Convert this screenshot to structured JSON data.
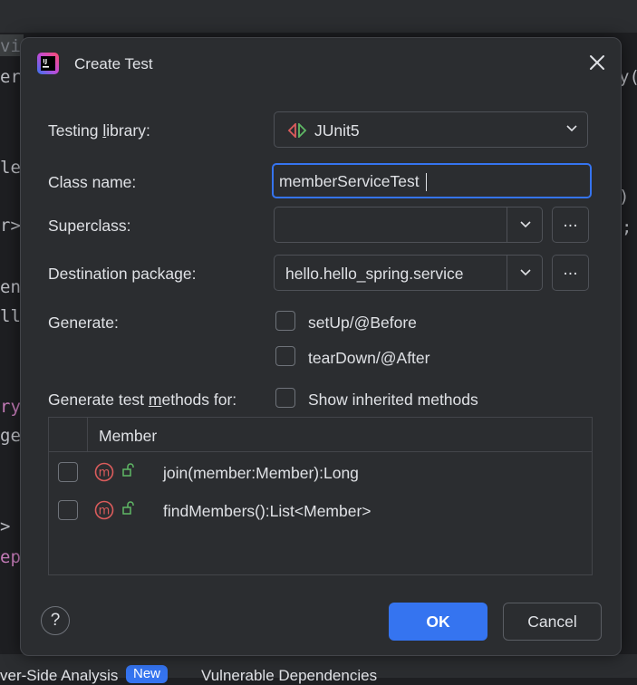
{
  "background": {
    "code_lines_left": [
      "vi",
      "er",
      "lem",
      "r>",
      "ent",
      "ll",
      "ry",
      "ge",
      ">",
      "ep"
    ],
    "code_lines_right": [
      "y(",
      ")",
      ";"
    ],
    "bottom_bar": {
      "item1": "ver-Side Analysis",
      "badge": "New",
      "item2": "Vulnerable Dependencies"
    }
  },
  "dialog": {
    "title": "Create Test",
    "icon": "intellij-idea-icon",
    "fields": {
      "testing_library": {
        "label_pre": "Testing ",
        "label_u": "l",
        "label_post": "ibrary:",
        "value": "JUnit5"
      },
      "class_name": {
        "label": "Class name:",
        "value": "memberServiceTest"
      },
      "superclass": {
        "label": "Superclass:",
        "value": "",
        "browse": "..."
      },
      "destination_package": {
        "label": "Destination package:",
        "value": "hello.hello_spring.service",
        "browse": "..."
      }
    },
    "generate": {
      "label": "Generate:",
      "options": [
        {
          "label": "setUp/@Before",
          "checked": false
        },
        {
          "label": "tearDown/@After",
          "checked": false
        }
      ]
    },
    "methods_for": {
      "label_pre": "Generate test ",
      "label_u": "m",
      "label_post": "ethods for:",
      "show_inherited": {
        "label": "Show inherited methods",
        "checked": false
      }
    },
    "table": {
      "header": "Member",
      "rows": [
        {
          "method": "join(member:Member):Long",
          "checked": false
        },
        {
          "method": "findMembers():List<Member>",
          "checked": false
        }
      ]
    },
    "buttons": {
      "help": "?",
      "ok": "OK",
      "cancel": "Cancel"
    }
  },
  "colors": {
    "accent": "#3574f0",
    "method_icon": "#db5c5c",
    "lock_icon": "#5fb865"
  }
}
